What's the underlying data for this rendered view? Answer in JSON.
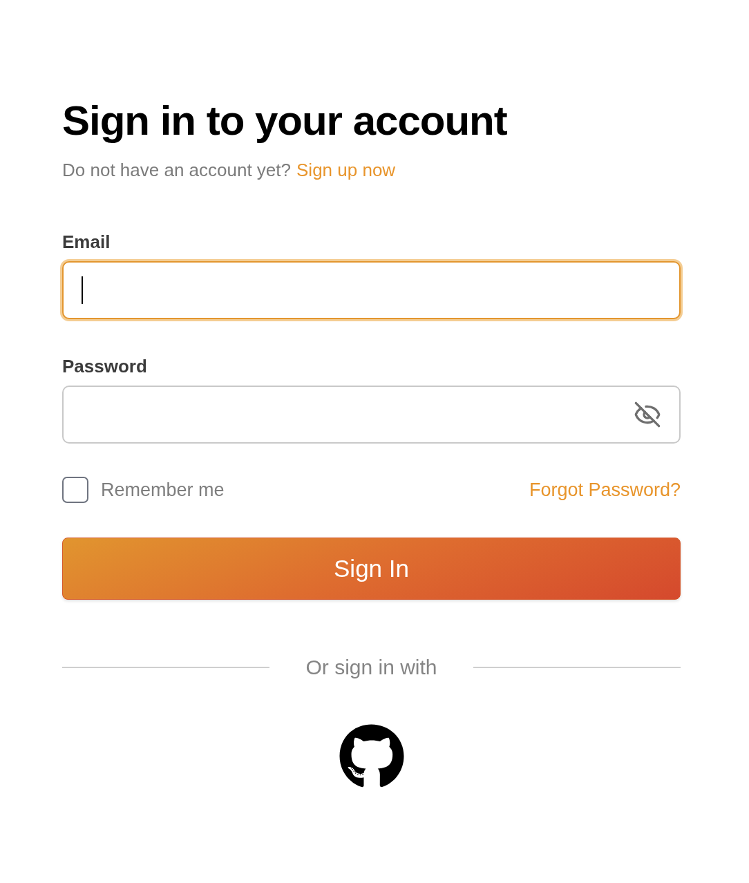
{
  "heading": "Sign in to your account",
  "signup_prompt": {
    "text": "Do not have an account yet?",
    "link": "Sign up now"
  },
  "fields": [
    {
      "kind": "email",
      "label": "Email",
      "focused": true
    },
    {
      "kind": "password",
      "label": "Password",
      "focused": false,
      "show_password": false
    }
  ],
  "remember": {
    "label": "Remember me",
    "checked": false
  },
  "forgot_link": "Forgot Password?",
  "submit": "Sign In",
  "divider": "Or sign in with"
}
